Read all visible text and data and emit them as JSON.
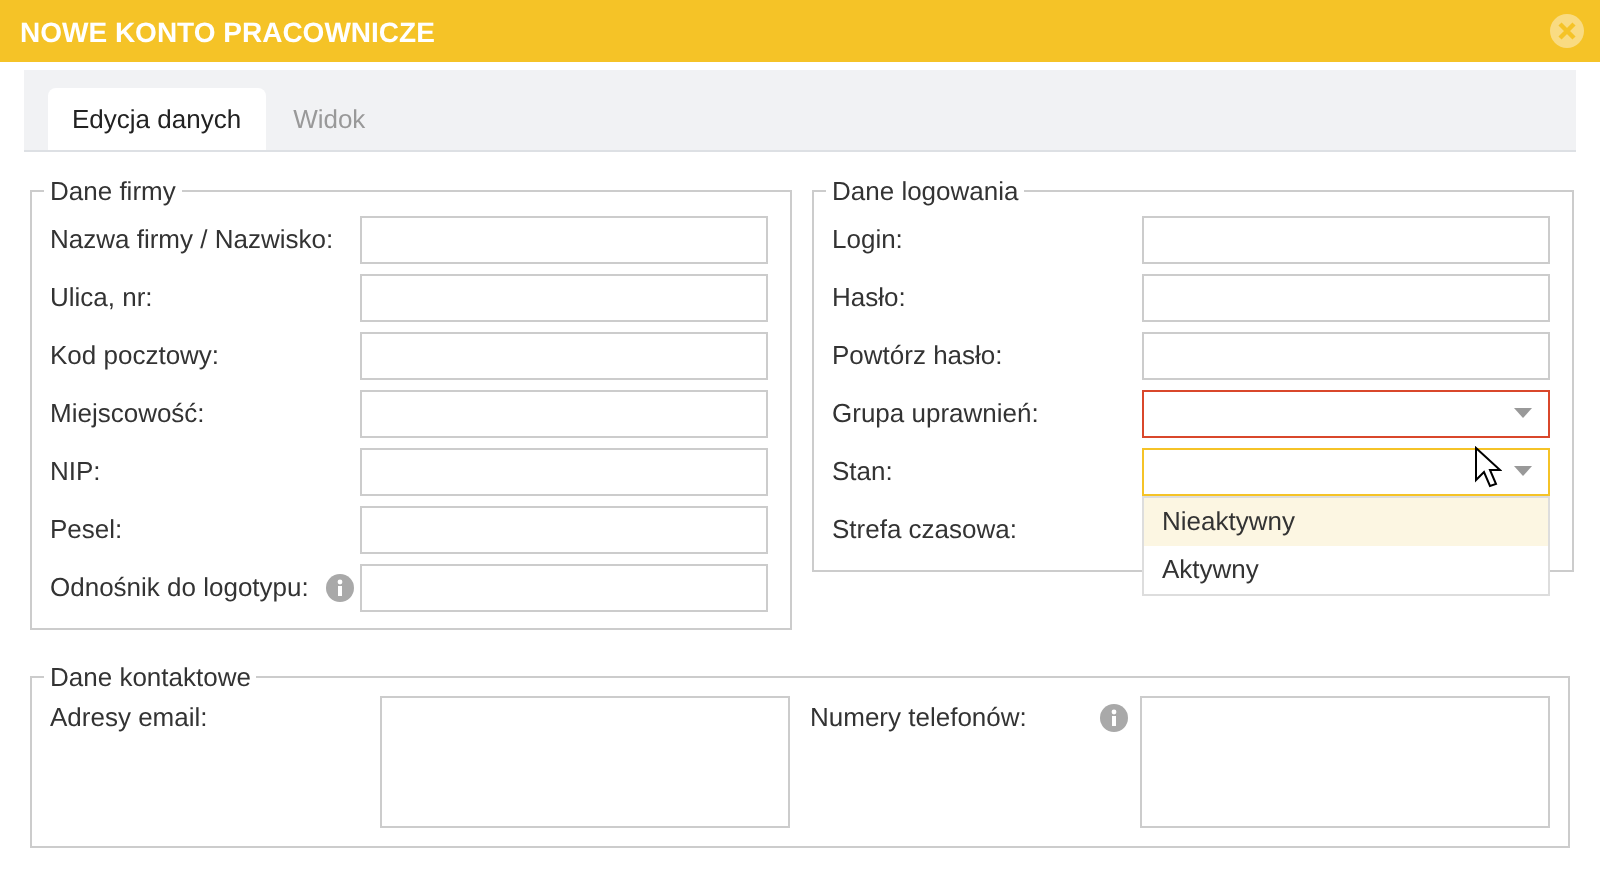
{
  "window": {
    "title": "NOWE KONTO PRACOWNICZE"
  },
  "tabs": [
    {
      "label": "Edycja danych",
      "selected": true
    },
    {
      "label": "Widok",
      "selected": false
    }
  ],
  "company": {
    "legend": "Dane firmy",
    "fields": [
      {
        "label": "Nazwa firmy / Nazwisko:",
        "kind": "text"
      },
      {
        "label": "Ulica, nr:",
        "kind": "text"
      },
      {
        "label": "Kod pocztowy:",
        "kind": "text"
      },
      {
        "label": "Miejscowość:",
        "kind": "text"
      },
      {
        "label": "NIP:",
        "kind": "text"
      },
      {
        "label": "Pesel:",
        "kind": "text"
      },
      {
        "label": "Odnośnik do logotypu:",
        "kind": "text",
        "info": true
      }
    ]
  },
  "login": {
    "legend": "Dane logowania",
    "fields": [
      {
        "label": "Login:",
        "kind": "text"
      },
      {
        "label": "Hasło:",
        "kind": "text"
      },
      {
        "label": "Powtórz hasło:",
        "kind": "text"
      },
      {
        "label": "Grupa uprawnień:",
        "kind": "select",
        "invalid": true,
        "open": false
      },
      {
        "label": "Stan:",
        "kind": "select",
        "invalid": false,
        "open": true,
        "options": [
          {
            "label": "Nieaktywny",
            "selected": true
          },
          {
            "label": "Aktywny",
            "selected": false
          }
        ]
      },
      {
        "label": "Strefa czasowa:",
        "kind": "covered"
      }
    ]
  },
  "contact": {
    "legend": "Dane kontaktowe",
    "fields": [
      {
        "label": "Adresy email:",
        "info": false
      },
      {
        "label": "Numery telefonów:",
        "info": true
      }
    ]
  }
}
